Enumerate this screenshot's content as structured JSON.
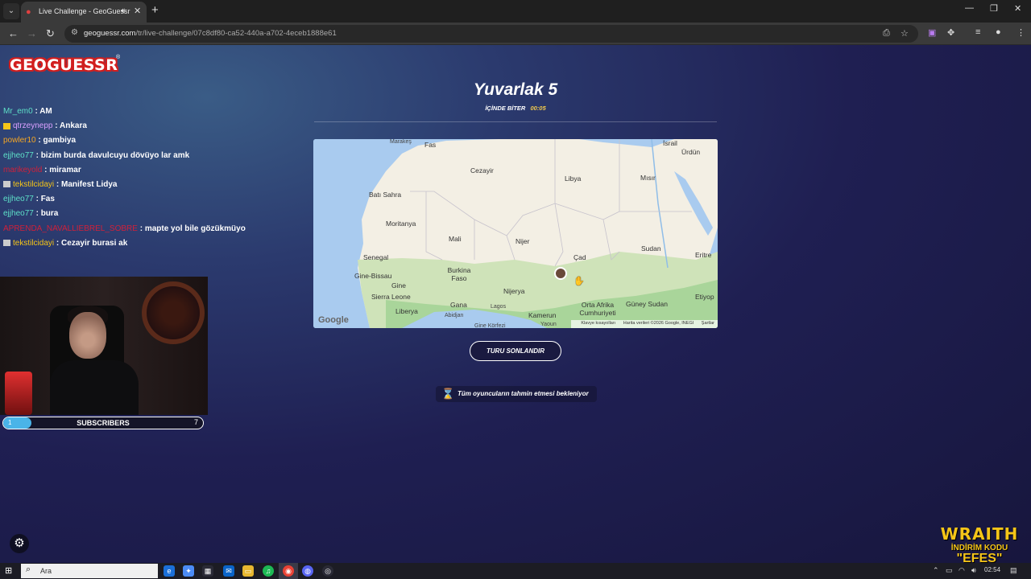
{
  "browser": {
    "tab_title": "Live Challenge - GeoGuessr",
    "url_host": "geoguessr.com",
    "url_path": "/tr/live-challenge/07c8df80-ca52-440a-a702-4eceb1888e61",
    "new_tab": "+",
    "tab_close": "✕"
  },
  "logo": {
    "text": "GEOGUESSR",
    "reg": "®"
  },
  "chat": [
    {
      "user": "Mr_em0",
      "message": "AM",
      "color": "#5ee0c8",
      "badge": ""
    },
    {
      "user": "qtrzeynepp",
      "message": "Ankara",
      "color": "#d9a0ff",
      "badge": "#f5c518"
    },
    {
      "user": "powler10",
      "message": "gambiya",
      "color": "#f5a623",
      "badge": ""
    },
    {
      "user": "ejjheo77",
      "message": "bizim burda davulcuyu dövüyo lar amk",
      "color": "#5ee0c8",
      "badge": ""
    },
    {
      "user": "marikeyold",
      "message": "miramar",
      "color": "#d0203a",
      "badge": ""
    },
    {
      "user": "tekstilcidayi",
      "message": "Manifest Lidya",
      "color": "#f5c518",
      "badge": "#cccccc"
    },
    {
      "user": "ejjheo77",
      "message": "Fas",
      "color": "#5ee0c8",
      "badge": ""
    },
    {
      "user": "ejjheo77",
      "message": "bura",
      "color": "#5ee0c8",
      "badge": ""
    },
    {
      "user": "APRENDA_NAVALLIEBREL_SOBRE",
      "message": "mapte yol bile gözükmüyo",
      "color": "#d0203a",
      "badge": ""
    },
    {
      "user": "tekstilcidayi",
      "message": "Cezayir burasi ak",
      "color": "#f5c518",
      "badge": "#cccccc"
    }
  ],
  "subscribers": {
    "left": "1",
    "label": "SUBSCRIBERS",
    "right": "7",
    "progress": 0.14
  },
  "round": {
    "title": "Yuvarlak 5",
    "timer_label": "İÇİNDE BİTER",
    "timer_value": "00:05"
  },
  "map": {
    "labels": [
      {
        "text": "Fas"
      },
      {
        "text": "Marakeş"
      },
      {
        "text": "Cezayir"
      },
      {
        "text": "Libya"
      },
      {
        "text": "Mısır"
      },
      {
        "text": "İsrail"
      },
      {
        "text": "Ürdün"
      },
      {
        "text": "Batı Sahra"
      },
      {
        "text": "Moritanya"
      },
      {
        "text": "Mali"
      },
      {
        "text": "Nijer"
      },
      {
        "text": "Çad"
      },
      {
        "text": "Sudan"
      },
      {
        "text": "Senegal"
      },
      {
        "text": "Eritre"
      },
      {
        "text": "Gine-Bissau"
      },
      {
        "text": "Burkina Faso"
      },
      {
        "text": "Gine"
      },
      {
        "text": "Nijerya"
      },
      {
        "text": "Sierra Leone"
      },
      {
        "text": "Liberya"
      },
      {
        "text": "Gana"
      },
      {
        "text": "Lagos"
      },
      {
        "text": "Abidjan"
      },
      {
        "text": "Kamerun"
      },
      {
        "text": "Orta Afrika Cumhuriyeti"
      },
      {
        "text": "Güney Sudan"
      },
      {
        "text": "Etiyop"
      },
      {
        "text": "Yaoun"
      },
      {
        "text": "Gine Körfezi"
      }
    ],
    "google": "Google",
    "footer": [
      "Klavye kısayolları",
      "Harita verileri ©2026 Google, INEGI",
      "Şartlar"
    ]
  },
  "end_button": "TURU SONLANDIR",
  "waiting": "Tüm oyuncuların tahmin etmesi bekleniyor",
  "promo": {
    "brand": "WRAITH",
    "line": "İNDİRİM KODU",
    "code": "\"EFES\""
  },
  "taskbar": {
    "search_placeholder": "Ara",
    "time": "02:54"
  },
  "colors": {
    "accent": "#f5c518",
    "logo_red": "#d21f1f",
    "sub_fill": "#4ab4e8"
  }
}
